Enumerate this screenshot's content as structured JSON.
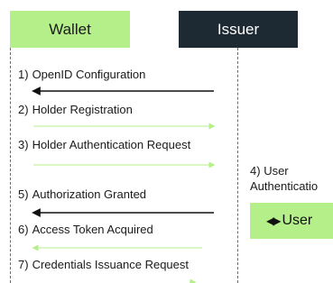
{
  "actors": {
    "wallet": {
      "label": "Wallet"
    },
    "issuer": {
      "label": "Issuer"
    }
  },
  "messages": [
    {
      "number": "1)",
      "label": "OpenID Configuration",
      "direction": "to-wallet",
      "style": "solid"
    },
    {
      "number": "2)",
      "label": "Holder Registration",
      "direction": "to-issuer",
      "style": "faint"
    },
    {
      "number": "3)",
      "label": "Holder Authentication Request",
      "direction": "to-issuer",
      "style": "faint"
    },
    {
      "number": "5)",
      "label": "Authorization Granted",
      "direction": "to-wallet",
      "style": "solid"
    },
    {
      "number": "6)",
      "label": "Access Token Acquired",
      "direction": "to-wallet",
      "style": "faint"
    },
    {
      "number": "7)",
      "label": "Credentials Issuance Request",
      "direction": "to-issuer",
      "style": "faint"
    }
  ],
  "note": {
    "number": "4)",
    "label": "User",
    "label_line2": "Authenticatio"
  },
  "activation": {
    "icon": "double-arrow-icon",
    "label": "User"
  },
  "colors": {
    "wallet_bg": "#b4ef8a",
    "issuer_bg": "#1e2a33",
    "solid_arrow": "#111111",
    "faint_arrow": "#b4ef8a"
  }
}
